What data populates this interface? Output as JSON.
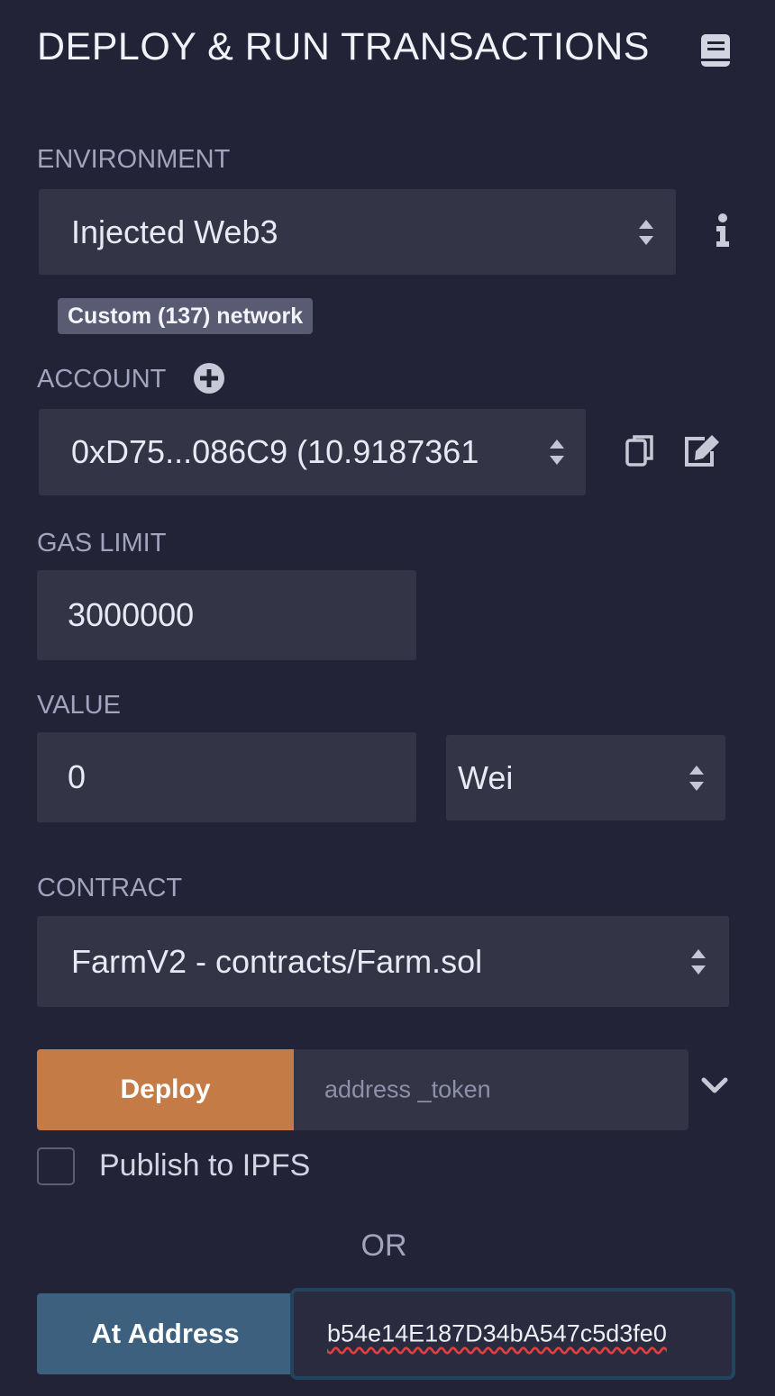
{
  "header": {
    "title": "DEPLOY & RUN TRANSACTIONS",
    "doc_icon": "book-icon"
  },
  "environment": {
    "label": "ENVIRONMENT",
    "selected": "Injected Web3",
    "info_icon": "info-icon",
    "network_badge": "Custom (137) network"
  },
  "account": {
    "label": "ACCOUNT",
    "add_icon": "plus-circle-icon",
    "selected": "0xD75...086C9 (10.9187361",
    "copy_icon": "copy-icon",
    "edit_icon": "edit-icon"
  },
  "gas_limit": {
    "label": "GAS LIMIT",
    "value": "3000000"
  },
  "value": {
    "label": "VALUE",
    "amount": "0",
    "unit": "Wei"
  },
  "contract": {
    "label": "CONTRACT",
    "selected": "FarmV2 - contracts/Farm.sol"
  },
  "deploy": {
    "button_label": "Deploy",
    "input_placeholder": "address _token",
    "expand_icon": "chevron-down-icon"
  },
  "publish": {
    "label": "Publish to IPFS",
    "checked": false
  },
  "separator": "OR",
  "at_address": {
    "button_label": "At Address",
    "input_value": "b54e14E187D34bA547c5d3fe0"
  },
  "colors": {
    "background": "#222336",
    "field": "#333446",
    "deploy": "#c57b46",
    "at_address": "#3c607e",
    "label": "#a2a3bd"
  }
}
